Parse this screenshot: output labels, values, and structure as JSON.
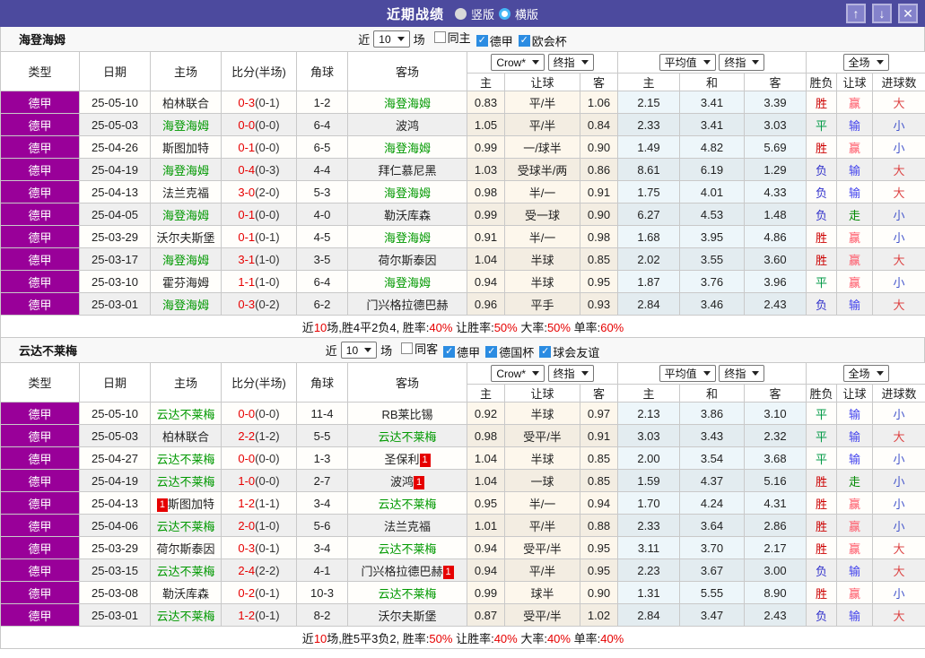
{
  "title_bar": {
    "title": "近期战绩",
    "vertical_label": "竖版",
    "horizontal_label": "横版",
    "buttons": {
      "up": "↑",
      "down": "↓",
      "close": "✕"
    }
  },
  "colors": {
    "accent": "#4c4a9e",
    "league_bg": "#990099",
    "target_team": "#009900",
    "score_red": "#e60000",
    "win": "#cc0000",
    "draw": "#009944",
    "lose": "#3333cc",
    "cover": "#ff5566",
    "not_cover": "#4444ee",
    "push": "#008800",
    "over": "#dd4444",
    "under": "#4455cc"
  },
  "table_head": {
    "columns": [
      "类型",
      "日期",
      "主场",
      "比分(半场)",
      "角球",
      "客场"
    ],
    "odds_group": {
      "bookmaker": "Crow*",
      "time": "终指"
    },
    "avg_group": {
      "name": "平均值",
      "time": "终指"
    },
    "scope_group": {
      "name": "全场"
    },
    "sub_columns": [
      "主",
      "让球",
      "客",
      "主",
      "和",
      "客",
      "胜负",
      "让球",
      "进球数"
    ]
  },
  "sections": [
    {
      "team": "海登海姆",
      "filter": {
        "near_label": "近",
        "count": "10",
        "games_label": "场",
        "checks": [
          {
            "label": "同主",
            "checked": false
          },
          {
            "label": "德甲",
            "checked": true
          },
          {
            "label": "欧会杯",
            "checked": true
          }
        ]
      },
      "rows": [
        {
          "league": "德甲",
          "date": "25-05-10",
          "home": {
            "name": "柏林联合",
            "target": false,
            "badge": ""
          },
          "score": "0-3",
          "half": "(0-1)",
          "corner": "1-2",
          "away": {
            "name": "海登海姆",
            "target": true,
            "badge": ""
          },
          "odds": [
            "0.83",
            "平/半",
            "1.06"
          ],
          "avg": [
            "2.15",
            "3.41",
            "3.39"
          ],
          "result": "胜",
          "hcp": "赢",
          "goals": "大"
        },
        {
          "league": "德甲",
          "date": "25-05-03",
          "home": {
            "name": "海登海姆",
            "target": true,
            "badge": ""
          },
          "score": "0-0",
          "half": "(0-0)",
          "corner": "6-4",
          "away": {
            "name": "波鸿",
            "target": false,
            "badge": ""
          },
          "odds": [
            "1.05",
            "平/半",
            "0.84"
          ],
          "avg": [
            "2.33",
            "3.41",
            "3.03"
          ],
          "result": "平",
          "hcp": "输",
          "goals": "小"
        },
        {
          "league": "德甲",
          "date": "25-04-26",
          "home": {
            "name": "斯图加特",
            "target": false,
            "badge": ""
          },
          "score": "0-1",
          "half": "(0-0)",
          "corner": "6-5",
          "away": {
            "name": "海登海姆",
            "target": true,
            "badge": ""
          },
          "odds": [
            "0.99",
            "一/球半",
            "0.90"
          ],
          "avg": [
            "1.49",
            "4.82",
            "5.69"
          ],
          "result": "胜",
          "hcp": "赢",
          "goals": "小"
        },
        {
          "league": "德甲",
          "date": "25-04-19",
          "home": {
            "name": "海登海姆",
            "target": true,
            "badge": ""
          },
          "score": "0-4",
          "half": "(0-3)",
          "corner": "4-4",
          "away": {
            "name": "拜仁慕尼黑",
            "target": false,
            "badge": ""
          },
          "odds": [
            "1.03",
            "受球半/两",
            "0.86"
          ],
          "avg": [
            "8.61",
            "6.19",
            "1.29"
          ],
          "result": "负",
          "hcp": "输",
          "goals": "大"
        },
        {
          "league": "德甲",
          "date": "25-04-13",
          "home": {
            "name": "法兰克福",
            "target": false,
            "badge": ""
          },
          "score": "3-0",
          "half": "(2-0)",
          "corner": "5-3",
          "away": {
            "name": "海登海姆",
            "target": true,
            "badge": ""
          },
          "odds": [
            "0.98",
            "半/一",
            "0.91"
          ],
          "avg": [
            "1.75",
            "4.01",
            "4.33"
          ],
          "result": "负",
          "hcp": "输",
          "goals": "大"
        },
        {
          "league": "德甲",
          "date": "25-04-05",
          "home": {
            "name": "海登海姆",
            "target": true,
            "badge": ""
          },
          "score": "0-1",
          "half": "(0-0)",
          "corner": "4-0",
          "away": {
            "name": "勒沃库森",
            "target": false,
            "badge": ""
          },
          "odds": [
            "0.99",
            "受一球",
            "0.90"
          ],
          "avg": [
            "6.27",
            "4.53",
            "1.48"
          ],
          "result": "负",
          "hcp": "走",
          "goals": "小"
        },
        {
          "league": "德甲",
          "date": "25-03-29",
          "home": {
            "name": "沃尔夫斯堡",
            "target": false,
            "badge": ""
          },
          "score": "0-1",
          "half": "(0-1)",
          "corner": "4-5",
          "away": {
            "name": "海登海姆",
            "target": true,
            "badge": ""
          },
          "odds": [
            "0.91",
            "半/一",
            "0.98"
          ],
          "avg": [
            "1.68",
            "3.95",
            "4.86"
          ],
          "result": "胜",
          "hcp": "赢",
          "goals": "小"
        },
        {
          "league": "德甲",
          "date": "25-03-17",
          "home": {
            "name": "海登海姆",
            "target": true,
            "badge": ""
          },
          "score": "3-1",
          "half": "(1-0)",
          "corner": "3-5",
          "away": {
            "name": "荷尔斯泰因",
            "target": false,
            "badge": ""
          },
          "odds": [
            "1.04",
            "半球",
            "0.85"
          ],
          "avg": [
            "2.02",
            "3.55",
            "3.60"
          ],
          "result": "胜",
          "hcp": "赢",
          "goals": "大"
        },
        {
          "league": "德甲",
          "date": "25-03-10",
          "home": {
            "name": "霍芬海姆",
            "target": false,
            "badge": ""
          },
          "score": "1-1",
          "half": "(1-0)",
          "corner": "6-4",
          "away": {
            "name": "海登海姆",
            "target": true,
            "badge": ""
          },
          "odds": [
            "0.94",
            "半球",
            "0.95"
          ],
          "avg": [
            "1.87",
            "3.76",
            "3.96"
          ],
          "result": "平",
          "hcp": "赢",
          "goals": "小"
        },
        {
          "league": "德甲",
          "date": "25-03-01",
          "home": {
            "name": "海登海姆",
            "target": true,
            "badge": ""
          },
          "score": "0-3",
          "half": "(0-2)",
          "corner": "6-2",
          "away": {
            "name": "门兴格拉德巴赫",
            "target": false,
            "badge": ""
          },
          "odds": [
            "0.96",
            "平手",
            "0.93"
          ],
          "avg": [
            "2.84",
            "3.46",
            "2.43"
          ],
          "result": "负",
          "hcp": "输",
          "goals": "大"
        }
      ],
      "summary": [
        {
          "t": "近"
        },
        {
          "t": "10",
          "red": true
        },
        {
          "t": "场,胜4平2负4, 胜率:"
        },
        {
          "t": "40%",
          "red": true
        },
        {
          "t": " 让胜率:"
        },
        {
          "t": "50%",
          "red": true
        },
        {
          "t": " 大率:"
        },
        {
          "t": "50%",
          "red": true
        },
        {
          "t": " 单率:"
        },
        {
          "t": "60%",
          "red": true
        }
      ]
    },
    {
      "team": "云达不莱梅",
      "filter": {
        "near_label": "近",
        "count": "10",
        "games_label": "场",
        "checks": [
          {
            "label": "同客",
            "checked": false
          },
          {
            "label": "德甲",
            "checked": true
          },
          {
            "label": "德国杯",
            "checked": true
          },
          {
            "label": "球会友谊",
            "checked": true
          }
        ]
      },
      "rows": [
        {
          "league": "德甲",
          "date": "25-05-10",
          "home": {
            "name": "云达不莱梅",
            "target": true,
            "badge": ""
          },
          "score": "0-0",
          "half": "(0-0)",
          "corner": "11-4",
          "away": {
            "name": "RB莱比锡",
            "target": false,
            "badge": ""
          },
          "odds": [
            "0.92",
            "半球",
            "0.97"
          ],
          "avg": [
            "2.13",
            "3.86",
            "3.10"
          ],
          "result": "平",
          "hcp": "输",
          "goals": "小"
        },
        {
          "league": "德甲",
          "date": "25-05-03",
          "home": {
            "name": "柏林联合",
            "target": false,
            "badge": ""
          },
          "score": "2-2",
          "half": "(1-2)",
          "corner": "5-5",
          "away": {
            "name": "云达不莱梅",
            "target": true,
            "badge": ""
          },
          "odds": [
            "0.98",
            "受平/半",
            "0.91"
          ],
          "avg": [
            "3.03",
            "3.43",
            "2.32"
          ],
          "result": "平",
          "hcp": "输",
          "goals": "大"
        },
        {
          "league": "德甲",
          "date": "25-04-27",
          "home": {
            "name": "云达不莱梅",
            "target": true,
            "badge": ""
          },
          "score": "0-0",
          "half": "(0-0)",
          "corner": "1-3",
          "away": {
            "name": "圣保利",
            "target": false,
            "badge": "1"
          },
          "odds": [
            "1.04",
            "半球",
            "0.85"
          ],
          "avg": [
            "2.00",
            "3.54",
            "3.68"
          ],
          "result": "平",
          "hcp": "输",
          "goals": "小"
        },
        {
          "league": "德甲",
          "date": "25-04-19",
          "home": {
            "name": "云达不莱梅",
            "target": true,
            "badge": ""
          },
          "score": "1-0",
          "half": "(0-0)",
          "corner": "2-7",
          "away": {
            "name": "波鸿",
            "target": false,
            "badge": "1"
          },
          "odds": [
            "1.04",
            "一球",
            "0.85"
          ],
          "avg": [
            "1.59",
            "4.37",
            "5.16"
          ],
          "result": "胜",
          "hcp": "走",
          "goals": "小"
        },
        {
          "league": "德甲",
          "date": "25-04-13",
          "home": {
            "name": "斯图加特",
            "target": false,
            "badge": "1"
          },
          "score": "1-2",
          "half": "(1-1)",
          "corner": "3-4",
          "away": {
            "name": "云达不莱梅",
            "target": true,
            "badge": ""
          },
          "odds": [
            "0.95",
            "半/一",
            "0.94"
          ],
          "avg": [
            "1.70",
            "4.24",
            "4.31"
          ],
          "result": "胜",
          "hcp": "赢",
          "goals": "小"
        },
        {
          "league": "德甲",
          "date": "25-04-06",
          "home": {
            "name": "云达不莱梅",
            "target": true,
            "badge": ""
          },
          "score": "2-0",
          "half": "(1-0)",
          "corner": "5-6",
          "away": {
            "name": "法兰克福",
            "target": false,
            "badge": ""
          },
          "odds": [
            "1.01",
            "平/半",
            "0.88"
          ],
          "avg": [
            "2.33",
            "3.64",
            "2.86"
          ],
          "result": "胜",
          "hcp": "赢",
          "goals": "小"
        },
        {
          "league": "德甲",
          "date": "25-03-29",
          "home": {
            "name": "荷尔斯泰因",
            "target": false,
            "badge": ""
          },
          "score": "0-3",
          "half": "(0-1)",
          "corner": "3-4",
          "away": {
            "name": "云达不莱梅",
            "target": true,
            "badge": ""
          },
          "odds": [
            "0.94",
            "受平/半",
            "0.95"
          ],
          "avg": [
            "3.11",
            "3.70",
            "2.17"
          ],
          "result": "胜",
          "hcp": "赢",
          "goals": "大"
        },
        {
          "league": "德甲",
          "date": "25-03-15",
          "home": {
            "name": "云达不莱梅",
            "target": true,
            "badge": ""
          },
          "score": "2-4",
          "half": "(2-2)",
          "corner": "4-1",
          "away": {
            "name": "门兴格拉德巴赫",
            "target": false,
            "badge": "1"
          },
          "odds": [
            "0.94",
            "平/半",
            "0.95"
          ],
          "avg": [
            "2.23",
            "3.67",
            "3.00"
          ],
          "result": "负",
          "hcp": "输",
          "goals": "大"
        },
        {
          "league": "德甲",
          "date": "25-03-08",
          "home": {
            "name": "勒沃库森",
            "target": false,
            "badge": ""
          },
          "score": "0-2",
          "half": "(0-1)",
          "corner": "10-3",
          "away": {
            "name": "云达不莱梅",
            "target": true,
            "badge": ""
          },
          "odds": [
            "0.99",
            "球半",
            "0.90"
          ],
          "avg": [
            "1.31",
            "5.55",
            "8.90"
          ],
          "result": "胜",
          "hcp": "赢",
          "goals": "小"
        },
        {
          "league": "德甲",
          "date": "25-03-01",
          "home": {
            "name": "云达不莱梅",
            "target": true,
            "badge": ""
          },
          "score": "1-2",
          "half": "(0-1)",
          "corner": "8-2",
          "away": {
            "name": "沃尔夫斯堡",
            "target": false,
            "badge": ""
          },
          "odds": [
            "0.87",
            "受平/半",
            "1.02"
          ],
          "avg": [
            "2.84",
            "3.47",
            "2.43"
          ],
          "result": "负",
          "hcp": "输",
          "goals": "大"
        }
      ],
      "summary": [
        {
          "t": "近"
        },
        {
          "t": "10",
          "red": true
        },
        {
          "t": "场,胜5平3负2, 胜率:"
        },
        {
          "t": "50%",
          "red": true
        },
        {
          "t": " 让胜率:"
        },
        {
          "t": "40%",
          "red": true
        },
        {
          "t": " 大率:"
        },
        {
          "t": "40%",
          "red": true
        },
        {
          "t": " 单率:"
        },
        {
          "t": "40%",
          "red": true
        }
      ]
    }
  ]
}
